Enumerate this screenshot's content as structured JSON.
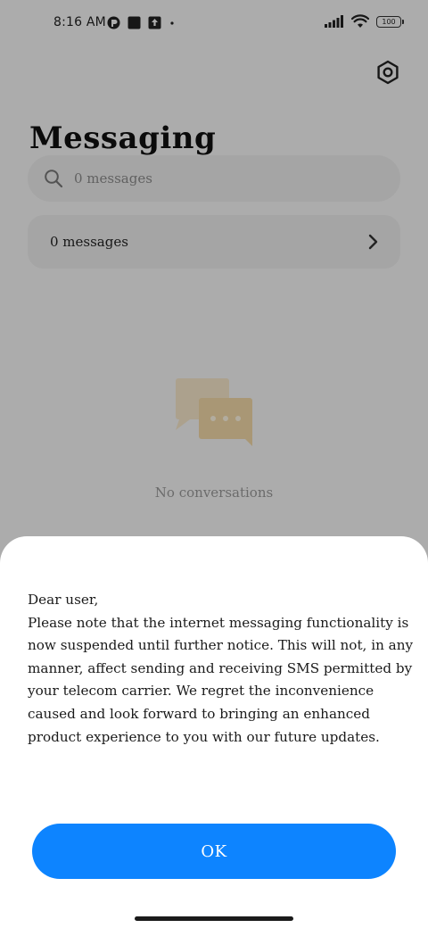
{
  "status_bar": {
    "time": "8:16 AM",
    "battery": "100"
  },
  "header": {
    "title": "Messaging"
  },
  "search": {
    "placeholder": "0 messages"
  },
  "messages_row": {
    "label": "0 messages"
  },
  "empty_state": {
    "text": "No conversations"
  },
  "dialog": {
    "message": "Dear user,\nPlease note that the internet messaging functionality is now suspended until further notice. This will not, in any manner, affect sending and receiving SMS permitted by your telecom carrier. We regret the inconvenience caused and look forward to bringing an enhanced product experience to you with our future updates.",
    "ok_label": "OK"
  },
  "colors": {
    "accent": "#0d84ff",
    "illustration": "#f2d9a8"
  },
  "icons": {
    "settings": "settings-icon",
    "search": "search-icon",
    "chevron": "chevron-right-icon",
    "empty": "chat-bubbles-icon"
  }
}
